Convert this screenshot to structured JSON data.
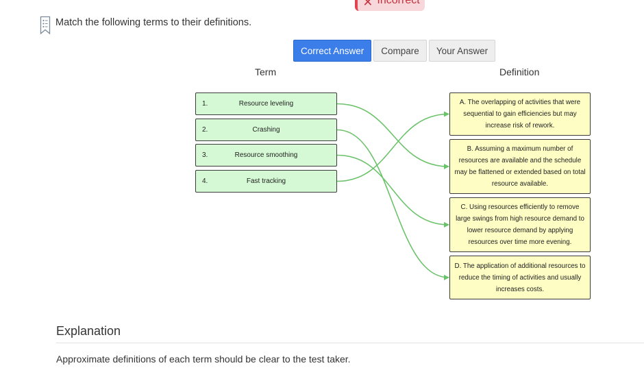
{
  "status": {
    "label": "Incorrect",
    "color": "#e3434f"
  },
  "question": {
    "text": "Match the following terms to their definitions."
  },
  "tabs": [
    {
      "label": "Correct Answer",
      "active": true
    },
    {
      "label": "Compare",
      "active": false
    },
    {
      "label": "Your Answer",
      "active": false
    }
  ],
  "columns": {
    "term": "Term",
    "definition": "Definition"
  },
  "terms": [
    {
      "num": "1.",
      "label": "Resource leveling"
    },
    {
      "num": "2.",
      "label": "Crashing"
    },
    {
      "num": "3.",
      "label": "Resource smoothing"
    },
    {
      "num": "4.",
      "label": "Fast tracking"
    }
  ],
  "definitions": [
    {
      "label": "A.  The overlapping of activities that were sequential to gain efficiencies but may increase risk of rework."
    },
    {
      "label": "B.    Assuming a maximum number of resources are available and the schedule may be flattened or extended based on total resource available."
    },
    {
      "label": "C.  Using resources efficiently to remove large swings from high resource demand to lower resource demand by applying resources over time more evening."
    },
    {
      "label": "D. The application of additional resources to reduce the timing of activities and usually increases costs."
    }
  ],
  "matches": [
    [
      0,
      1
    ],
    [
      1,
      3
    ],
    [
      2,
      2
    ],
    [
      3,
      0
    ]
  ],
  "line_color": "#6cc26a",
  "explanation": {
    "title": "Explanation",
    "text": "Approximate definitions of each term should be clear to the test taker."
  }
}
